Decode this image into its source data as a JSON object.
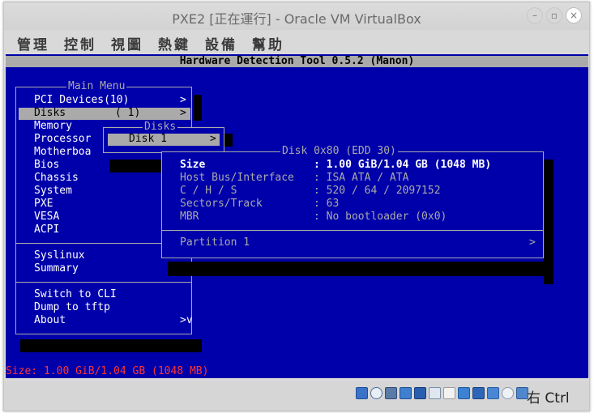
{
  "window": {
    "title": "PXE2 [正在運行] - Oracle VM VirtualBox",
    "controls": {
      "minimize": "–",
      "maximize": "▫",
      "close": "×"
    }
  },
  "menubar": [
    "管理",
    "控制",
    "視圖",
    "熱鍵",
    "設備",
    "幫助"
  ],
  "hdt": {
    "header": "Hardware Detection Tool 0.5.2 (Manon)",
    "main_menu": {
      "title": "Main Menu",
      "items": [
        {
          "label": "PCI Devices(10)",
          "arrow": ">"
        },
        {
          "label": "Disks",
          "count": "( 1)",
          "arrow": ">"
        },
        {
          "label": "Memory"
        },
        {
          "label": "Processor"
        },
        {
          "label": "Motherboa"
        },
        {
          "label": "Bios"
        },
        {
          "label": "Chassis"
        },
        {
          "label": "System"
        },
        {
          "label": "PXE"
        },
        {
          "label": "VESA"
        },
        {
          "label": "ACPI"
        },
        {
          "label": "Syslinux"
        },
        {
          "label": "Summary"
        },
        {
          "label": "Switch to CLI"
        },
        {
          "label": "Dump to tftp"
        },
        {
          "label": "About",
          "arrow": ">v"
        }
      ]
    },
    "disks_menu": {
      "title": "Disks",
      "items": [
        {
          "label": "Disk 1",
          "arrow": ">"
        }
      ]
    },
    "disk_detail": {
      "title": "Disk 0x80 (EDD 30)",
      "rows": [
        {
          "key": "Size",
          "value": ": 1.00 GiB/1.04 GB (1048 MB)"
        },
        {
          "key": "Host Bus/Interface",
          "value": ": ISA ATA / ATA"
        },
        {
          "key": "C / H / S",
          "value": ": 520 / 64 / 2097152"
        },
        {
          "key": "Sectors/Track",
          "value": ": 63"
        },
        {
          "key": "MBR",
          "value": ": No bootloader (0x0)"
        }
      ],
      "partition": {
        "label": "Partition 1",
        "arrow": ">"
      }
    },
    "status": "Size: 1.00 GiB/1.04 GB (1048 MB)"
  },
  "statusbar": {
    "host_key": "右 Ctrl",
    "icons": [
      "hard-disk-icon",
      "optical-disc-icon",
      "audio-icon",
      "network-icon",
      "usb-icon",
      "pen-icon",
      "shared-folder-icon",
      "display-icon",
      "video-capture-icon",
      "virtualization-icon",
      "mouse-integration-icon",
      "floppy-icon",
      "download-arrow-icon"
    ]
  }
}
